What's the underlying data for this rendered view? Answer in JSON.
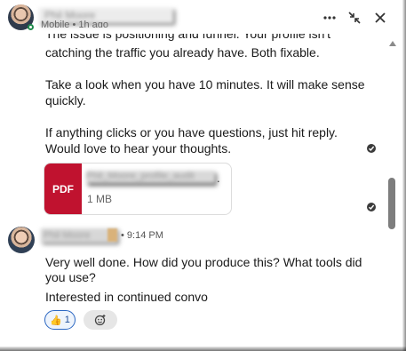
{
  "header": {
    "name": "Phil Moore",
    "status": "Mobile • 1h ago",
    "more_label": "···"
  },
  "messages_prev": {
    "line_partial": "The issue is positioning and funnel. Your profile isn't",
    "line_1": "catching the traffic you already have. Both fixable.",
    "para_2_line_1": "Take a look when you have 10 minutes. It will make sense",
    "para_2_line_2": "quickly.",
    "para_3_line_1": "If anything clicks or you have questions, just hit reply.",
    "para_3_line_2": "Would love to hear your thoughts."
  },
  "attachment": {
    "type_label": "PDF",
    "file_name": "Phil_Moore_profile_audit",
    "suffix": ".",
    "size": "1 MB"
  },
  "reply": {
    "sender": "Phil Moore",
    "time": "• 9:14 PM",
    "line_1": "Very well done. How did you produce this? What tools did",
    "line_2": "you use?",
    "line_3": "Interested in continued convo"
  },
  "reaction": {
    "emoji": "👍",
    "count": "1"
  },
  "colors": {
    "pdf_red": "#c0122f",
    "reaction_blue": "#2a66c2",
    "online_green": "#1f8a4c"
  }
}
